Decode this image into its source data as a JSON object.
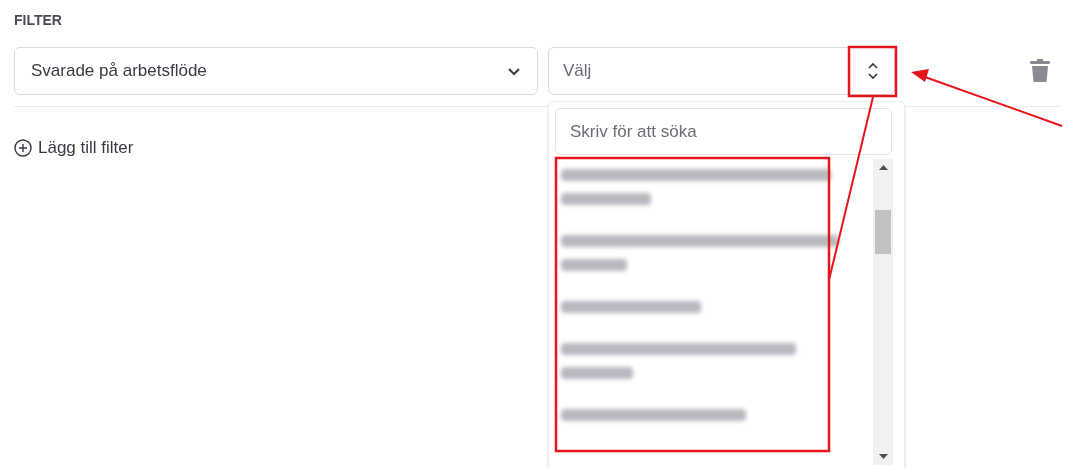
{
  "heading": "FILTER",
  "filter_row": {
    "field_select": {
      "value": "Svarade på arbetsflöde"
    },
    "value_select": {
      "placeholder": "Välj",
      "expanded": true
    }
  },
  "add_filter": "Lägg till filter",
  "dropdown": {
    "search": {
      "placeholder": "Skriv för att söka"
    },
    "options": [
      {
        "kind": "two-line"
      },
      {
        "kind": "two-line"
      },
      {
        "kind": "one-line"
      },
      {
        "kind": "two-line"
      },
      {
        "kind": "one-line"
      }
    ]
  }
}
